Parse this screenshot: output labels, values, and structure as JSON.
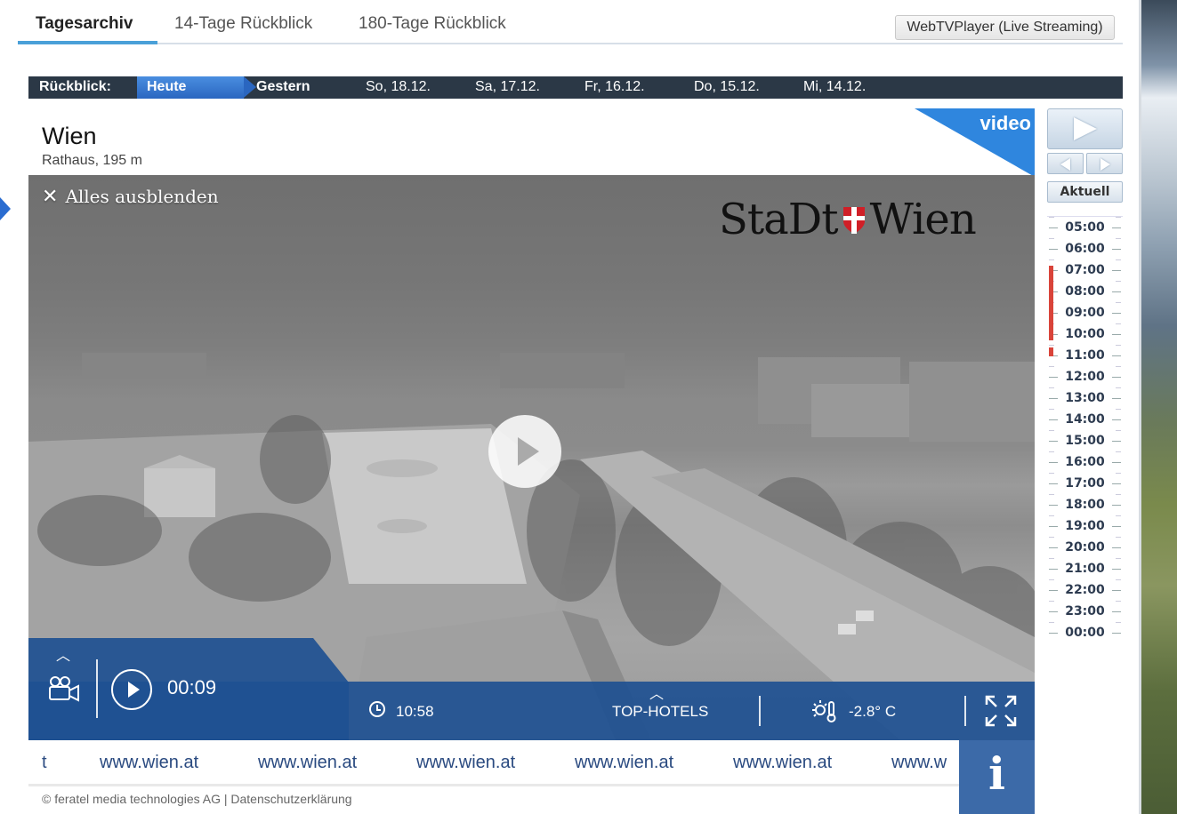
{
  "tabs": [
    {
      "label": "Tagesarchiv",
      "active": true
    },
    {
      "label": "14-Tage Rückblick",
      "active": false
    },
    {
      "label": "180-Tage Rückblick",
      "active": false
    }
  ],
  "live_button": "WebTVPlayer (Live Streaming)",
  "daybar": {
    "label": "Rückblick:",
    "today": "Heute",
    "days": [
      "Gestern",
      "So, 18.12.",
      "Sa, 17.12.",
      "Fr, 16.12.",
      "Do, 15.12.",
      "Mi, 14.12."
    ]
  },
  "location": {
    "name": "Wien",
    "subtitle": "Rathaus, 195 m"
  },
  "video_badge": "video",
  "overlay": {
    "hide_all": "Alles ausblenden",
    "logo_left": "StaDt",
    "logo_right": "Wien",
    "elapsed": "00:09",
    "clock_time": "10:58",
    "hotels": "TOP-HOTELS",
    "temperature": "-2.8° C"
  },
  "ticker": {
    "items": [
      "t",
      "www.wien.at",
      "www.wien.at",
      "www.wien.at",
      "www.wien.at",
      "www.wien.at",
      "www.w"
    ]
  },
  "info_glyph": "i",
  "footer": "© feratel media technologies AG  |  Datenschutzerklärung",
  "timeline": {
    "aktuell": "Aktuell",
    "hours": [
      "05:00",
      "06:00",
      "07:00",
      "08:00",
      "09:00",
      "10:00",
      "11:00",
      "12:00",
      "13:00",
      "14:00",
      "15:00",
      "16:00",
      "17:00",
      "18:00",
      "19:00",
      "20:00",
      "21:00",
      "22:00",
      "23:00",
      "00:00"
    ]
  },
  "colors": {
    "accent": "#2a66c0",
    "overlay_blue": "#1e5091",
    "avail_red": "#d9443a",
    "daybar": "#2b3846"
  },
  "icons": [
    "close-icon",
    "chevron-up-icon",
    "camera-icon",
    "play-icon",
    "clock-icon",
    "sun-thermometer-icon",
    "fullscreen-icon",
    "info-icon",
    "step-back-icon",
    "step-forward-icon"
  ]
}
